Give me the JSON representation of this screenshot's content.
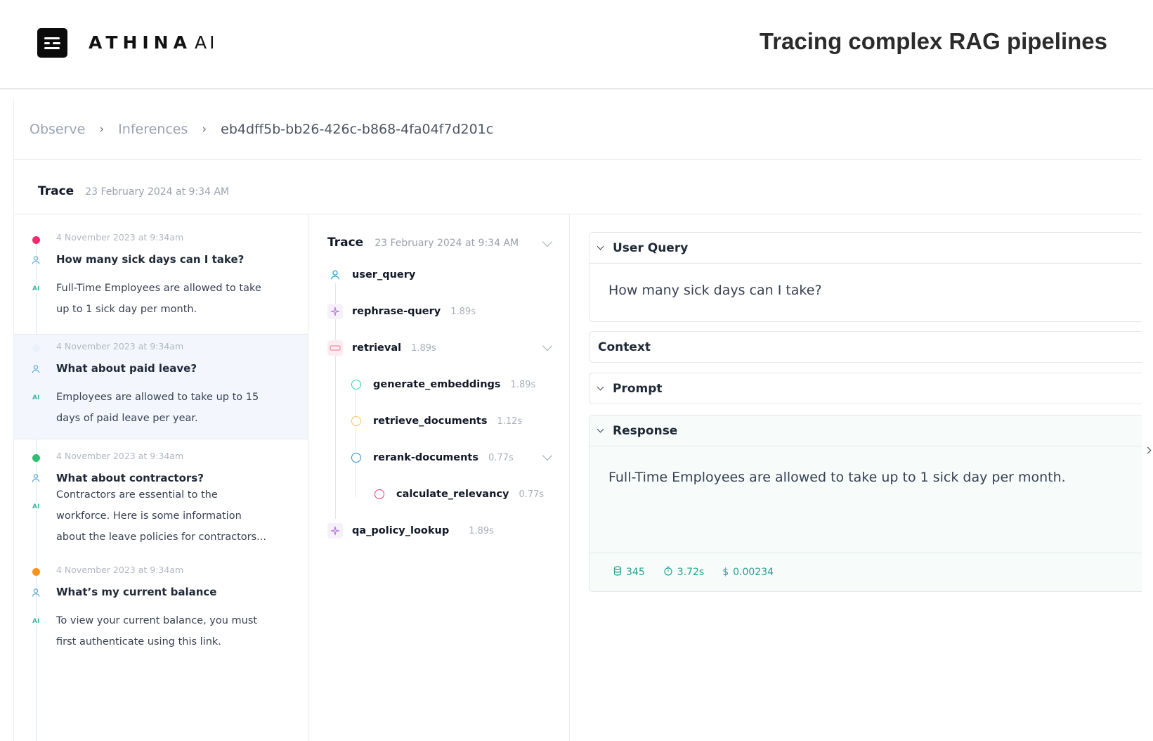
{
  "header": {
    "brand_name": "ATHINA",
    "brand_suffix": "AI",
    "headline": "Tracing complex RAG pipelines"
  },
  "breadcrumb": {
    "items": [
      "Observe",
      "Inferences"
    ],
    "current": "eb4dff5b-bb26-426c-b868-4fa04f7d201c"
  },
  "trace_header": {
    "title": "Trace",
    "date": "23 February 2024 at 9:34 AM"
  },
  "conversations": [
    {
      "timestamp": "4 November 2023 at 9:34am",
      "question": "How many sick days can I take?",
      "ai_label": "AI",
      "answer": "Full-Time Employees are allowed to take up to 1 sick day per month.",
      "dot_color": "#ef2d6e"
    },
    {
      "timestamp": "4 November 2023 at 9:34am",
      "question": "What about paid leave?",
      "ai_label": "AI",
      "answer": "Employees are allowed to take up to 15 days of paid leave per year.",
      "dot_color": "#e9f1fb"
    },
    {
      "timestamp": "4 November 2023 at 9:34am",
      "question": "What about contractors?",
      "ai_label": "AI",
      "answer": "Contractors are essential to the workforce. Here is some information about the leave policies for contractors...",
      "dot_color": "#2fbf71"
    },
    {
      "timestamp": "4 November 2023 at 9:34am",
      "question": "What’s my current balance",
      "ai_label": "AI",
      "answer": "To view your current balance, you must first authenticate using this link.",
      "dot_color": "#f7941d"
    }
  ],
  "trace_tree": {
    "title": "Trace",
    "date": "23 February 2024 at 9:34 AM",
    "nodes": [
      {
        "name": "user_query",
        "time": "",
        "icon": "user-icon"
      },
      {
        "name": "rephrase-query",
        "time": "1.89s",
        "icon": "sparkle-icon"
      },
      {
        "name": "retrieval",
        "time": "1.89s",
        "icon": "retrieval-icon"
      },
      {
        "name": "generate_embeddings",
        "time": "1.89s",
        "icon": "ring-icon",
        "color": "#2ad1b8"
      },
      {
        "name": "retrieve_documents",
        "time": "1.12s",
        "icon": "ring-icon",
        "color": "#f7c65a"
      },
      {
        "name": "rerank-documents",
        "time": "0.77s",
        "icon": "ring-icon",
        "color": "#2d8ed6"
      },
      {
        "name": "calculate_relevancy",
        "time": "0.77s",
        "icon": "ring-icon",
        "color": "#e83e74"
      },
      {
        "name": "qa_policy_lookup",
        "time": "1.89s",
        "icon": "sparkle-icon"
      }
    ]
  },
  "detail": {
    "user_query": {
      "title": "User Query",
      "text": "How many sick days can I take?"
    },
    "context": {
      "title": "Context"
    },
    "prompt": {
      "title": "Prompt"
    },
    "response": {
      "title": "Response",
      "text": "Full-Time Employees are allowed to take up to 1 sick day per month."
    },
    "metrics": {
      "tokens": "345",
      "latency": "3.72s",
      "cost": "0.00234"
    }
  }
}
